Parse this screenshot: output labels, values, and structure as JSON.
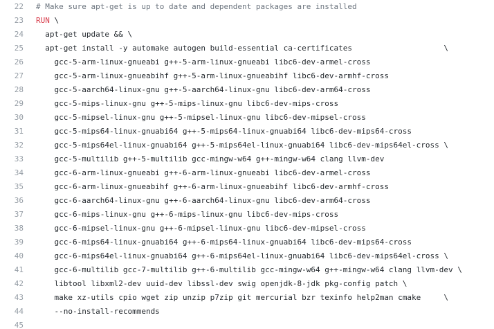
{
  "file_view": {
    "lines": [
      {
        "num": "22",
        "segments": [
          {
            "text": "# Make sure apt-get is up to date and dependent packages are installed",
            "type": "comment"
          }
        ]
      },
      {
        "num": "23",
        "segments": [
          {
            "text": "RUN",
            "type": "keyword"
          },
          {
            "text": " \\",
            "type": "plain"
          }
        ]
      },
      {
        "num": "24",
        "segments": [
          {
            "text": "  apt-get update && \\",
            "type": "plain"
          }
        ]
      },
      {
        "num": "25",
        "segments": [
          {
            "text": "  apt-get install -y automake autogen build-essential ca-certificates                    \\",
            "type": "plain"
          }
        ]
      },
      {
        "num": "26",
        "segments": [
          {
            "text": "    gcc-5-arm-linux-gnueabi g++-5-arm-linux-gnueabi libc6-dev-armel-cross",
            "type": "plain"
          }
        ]
      },
      {
        "num": "27",
        "segments": [
          {
            "text": "    gcc-5-arm-linux-gnueabihf g++-5-arm-linux-gnueabihf libc6-dev-armhf-cross",
            "type": "plain"
          }
        ]
      },
      {
        "num": "28",
        "segments": [
          {
            "text": "    gcc-5-aarch64-linux-gnu g++-5-aarch64-linux-gnu libc6-dev-arm64-cross",
            "type": "plain"
          }
        ]
      },
      {
        "num": "29",
        "segments": [
          {
            "text": "    gcc-5-mips-linux-gnu g++-5-mips-linux-gnu libc6-dev-mips-cross",
            "type": "plain"
          }
        ]
      },
      {
        "num": "30",
        "segments": [
          {
            "text": "    gcc-5-mipsel-linux-gnu g++-5-mipsel-linux-gnu libc6-dev-mipsel-cross",
            "type": "plain"
          }
        ]
      },
      {
        "num": "31",
        "segments": [
          {
            "text": "    gcc-5-mips64-linux-gnuabi64 g++-5-mips64-linux-gnuabi64 libc6-dev-mips64-cross",
            "type": "plain"
          }
        ]
      },
      {
        "num": "32",
        "segments": [
          {
            "text": "    gcc-5-mips64el-linux-gnuabi64 g++-5-mips64el-linux-gnuabi64 libc6-dev-mips64el-cross \\",
            "type": "plain"
          }
        ]
      },
      {
        "num": "33",
        "segments": [
          {
            "text": "    gcc-5-multilib g++-5-multilib gcc-mingw-w64 g++-mingw-w64 clang llvm-dev",
            "type": "plain"
          }
        ]
      },
      {
        "num": "34",
        "segments": [
          {
            "text": "    gcc-6-arm-linux-gnueabi g++-6-arm-linux-gnueabi libc6-dev-armel-cross",
            "type": "plain"
          }
        ]
      },
      {
        "num": "35",
        "segments": [
          {
            "text": "    gcc-6-arm-linux-gnueabihf g++-6-arm-linux-gnueabihf libc6-dev-armhf-cross",
            "type": "plain"
          }
        ]
      },
      {
        "num": "36",
        "segments": [
          {
            "text": "    gcc-6-aarch64-linux-gnu g++-6-aarch64-linux-gnu libc6-dev-arm64-cross",
            "type": "plain"
          }
        ]
      },
      {
        "num": "37",
        "segments": [
          {
            "text": "    gcc-6-mips-linux-gnu g++-6-mips-linux-gnu libc6-dev-mips-cross",
            "type": "plain"
          }
        ]
      },
      {
        "num": "38",
        "segments": [
          {
            "text": "    gcc-6-mipsel-linux-gnu g++-6-mipsel-linux-gnu libc6-dev-mipsel-cross",
            "type": "plain"
          }
        ]
      },
      {
        "num": "39",
        "segments": [
          {
            "text": "    gcc-6-mips64-linux-gnuabi64 g++-6-mips64-linux-gnuabi64 libc6-dev-mips64-cross",
            "type": "plain"
          }
        ]
      },
      {
        "num": "40",
        "segments": [
          {
            "text": "    gcc-6-mips64el-linux-gnuabi64 g++-6-mips64el-linux-gnuabi64 libc6-dev-mips64el-cross \\",
            "type": "plain"
          }
        ]
      },
      {
        "num": "41",
        "segments": [
          {
            "text": "    gcc-6-multilib gcc-7-multilib g++-6-multilib gcc-mingw-w64 g++-mingw-w64 clang llvm-dev \\",
            "type": "plain"
          }
        ]
      },
      {
        "num": "42",
        "segments": [
          {
            "text": "    libtool libxml2-dev uuid-dev libssl-dev swig openjdk-8-jdk pkg-config patch \\",
            "type": "plain"
          }
        ]
      },
      {
        "num": "43",
        "segments": [
          {
            "text": "    make xz-utils cpio wget zip unzip p7zip git mercurial bzr texinfo help2man cmake     \\",
            "type": "plain"
          }
        ]
      },
      {
        "num": "44",
        "segments": [
          {
            "text": "    --no-install-recommends",
            "type": "plain"
          }
        ]
      },
      {
        "num": "45",
        "segments": []
      }
    ],
    "colors": {
      "line_number": "#959da5",
      "comment": "#6a737d",
      "keyword": "#d73a49",
      "text": "#24292e",
      "background": "#ffffff"
    }
  }
}
